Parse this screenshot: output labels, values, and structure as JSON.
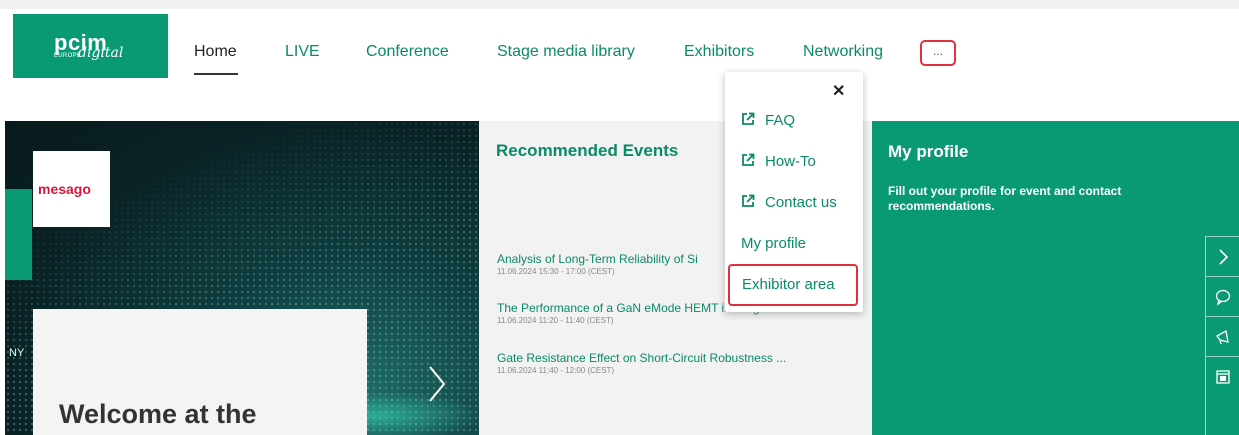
{
  "logo": {
    "brand": "pcim",
    "sub": "EUROPE",
    "script": "digital"
  },
  "nav": {
    "items": [
      "Home",
      "LIVE",
      "Conference",
      "Stage media library",
      "Exhibitors",
      "Networking"
    ],
    "more_label": "..."
  },
  "hero": {
    "partner": "mesago",
    "side_text": "NY",
    "welcome": "Welcome at the"
  },
  "recommended": {
    "title": "Recommended Events",
    "events": [
      {
        "title": "Analysis of Long-Term Reliability of Si",
        "time": "11.06.2024 15:30 - 17:00 (CEST)"
      },
      {
        "title": "The Performance of a GaN eMode HEMT in Surge C...",
        "time": "11.06.2024 11:20 - 11:40 (CEST)"
      },
      {
        "title": "Gate Resistance Effect on Short-Circuit Robustness ...",
        "time": "11.06.2024 11:40 - 12:00 (CEST)"
      }
    ]
  },
  "profile": {
    "title": "My profile",
    "text": "Fill out your profile for event and contact recommendations."
  },
  "menu": {
    "close": "✕",
    "items": [
      "FAQ",
      "How-To",
      "Contact us",
      "My profile"
    ],
    "exhibitor": "Exhibitor area"
  },
  "colors": {
    "brand_green": "#0a9a73",
    "link_green": "#0a8a68",
    "highlight_red": "#e03040"
  },
  "side_icons": [
    "chevron-right-icon",
    "chat-icon",
    "megaphone-icon",
    "calendar-icon"
  ]
}
